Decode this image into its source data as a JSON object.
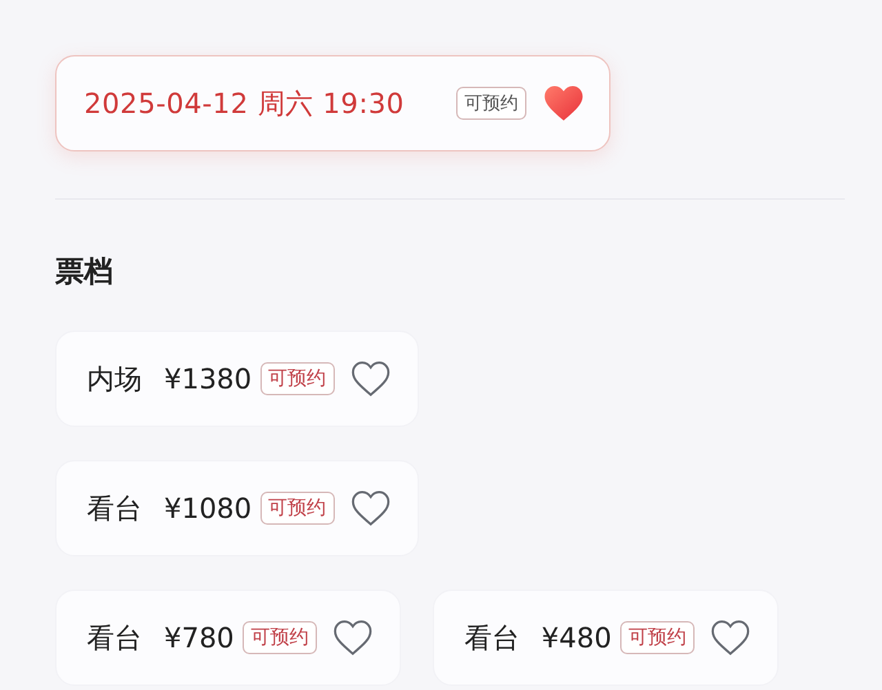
{
  "sessions": [
    {
      "label": "2025-04-12 周六 19:30",
      "badge": "可预约",
      "selected": true
    }
  ],
  "tickets_title": "票档",
  "ticket_rows": [
    [
      {
        "zone": "内场",
        "price": "¥1380",
        "badge": "可预约",
        "selected": false
      }
    ],
    [
      {
        "zone": "看台",
        "price": "¥1080",
        "badge": "可预约",
        "selected": false
      }
    ],
    [
      {
        "zone": "看台",
        "price": "¥780",
        "badge": "可预约",
        "selected": false
      },
      {
        "zone": "看台",
        "price": "¥480",
        "badge": "可预约",
        "selected": false
      }
    ]
  ]
}
